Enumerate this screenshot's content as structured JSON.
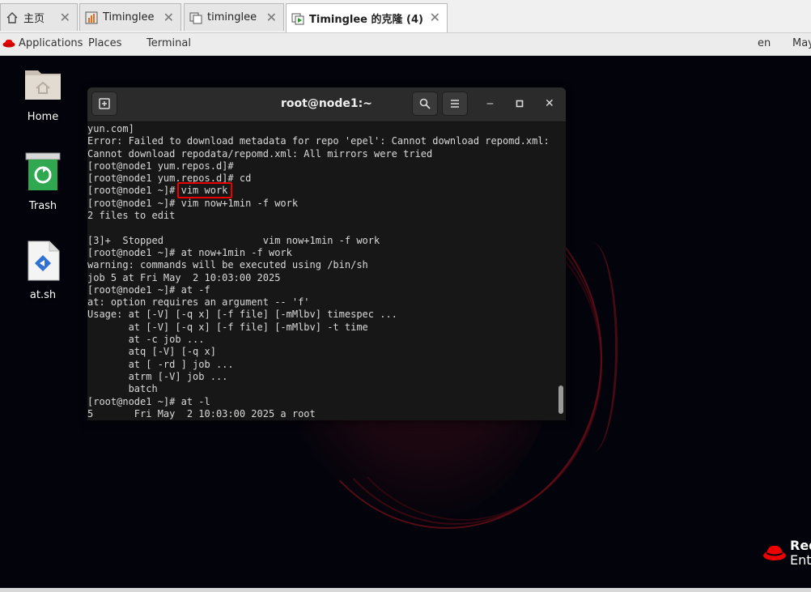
{
  "tabs": [
    {
      "label": "主页",
      "icon": "home-icon",
      "active": false
    },
    {
      "label": "Timinglee",
      "icon": "vm-icon",
      "active": false
    },
    {
      "label": "timinglee",
      "icon": "vm-tab-icon",
      "active": false
    },
    {
      "label": "Timinglee 的克隆 (4)",
      "icon": "vm-running-icon",
      "active": true
    }
  ],
  "topbar": {
    "applications": "Applications",
    "places": "Places",
    "terminal": "Terminal",
    "lang": "en",
    "date": "May"
  },
  "desktop_icons": [
    {
      "label": "Home",
      "icon": "folder-home-icon"
    },
    {
      "label": "Trash",
      "icon": "trash-icon"
    },
    {
      "label": "at.sh",
      "icon": "script-file-icon"
    }
  ],
  "brand": {
    "line1": "Red",
    "line2": "Ente"
  },
  "terminal": {
    "title": "root@node1:~",
    "lines": [
      "yun.com]",
      "Error: Failed to download metadata for repo 'epel': Cannot download repomd.xml:",
      "Cannot download repodata/repomd.xml: All mirrors were tried",
      "[root@node1 yum.repos.d]#",
      "[root@node1 yum.repos.d]# cd",
      "[root@node1 ~]# vim work",
      "[root@node1 ~]# vim now+1min -f work",
      "2 files to edit",
      "",
      "[3]+  Stopped                 vim now+1min -f work",
      "[root@node1 ~]# at now+1min -f work",
      "warning: commands will be executed using /bin/sh",
      "job 5 at Fri May  2 10:03:00 2025",
      "[root@node1 ~]# at -f",
      "at: option requires an argument -- 'f'",
      "Usage: at [-V] [-q x] [-f file] [-mMlbv] timespec ...",
      "       at [-V] [-q x] [-f file] [-mMlbv] -t time",
      "       at -c job ...",
      "       atq [-V] [-q x]",
      "       at [ -rd ] job ...",
      "       atrm [-V] job ...",
      "       batch",
      "[root@node1 ~]# at -l",
      "5       Fri May  2 10:03:00 2025 a root"
    ]
  },
  "colors": {
    "highlight": "#e00000",
    "desktop": "#03030b",
    "terminal_bg": "#171717"
  }
}
